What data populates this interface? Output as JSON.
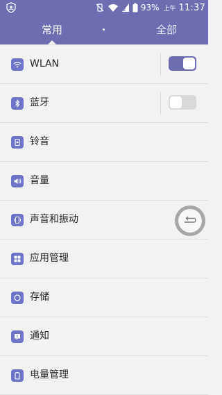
{
  "status_bar": {
    "battery": "93%",
    "time_prefix": "上午",
    "time": "11:37"
  },
  "tabs": [
    {
      "label": "常用",
      "selected": true
    },
    {
      "label": "全部",
      "selected": false
    }
  ],
  "settings": [
    {
      "label": "WLAN",
      "icon": "wifi-icon",
      "toggle": true
    },
    {
      "label": "蓝牙",
      "icon": "bluetooth-icon",
      "toggle": false
    },
    {
      "label": "铃音",
      "icon": "ringtone-icon"
    },
    {
      "label": "音量",
      "icon": "volume-icon"
    },
    {
      "label": "声音和振动",
      "icon": "vibrate-icon"
    },
    {
      "label": "应用管理",
      "icon": "apps-icon"
    },
    {
      "label": "存储",
      "icon": "storage-icon"
    },
    {
      "label": "通知",
      "icon": "notification-icon"
    },
    {
      "label": "电量管理",
      "icon": "battery-manage-icon"
    }
  ],
  "colors": {
    "accent": "#6e6db2",
    "icon_bg": "#6e75c8",
    "background": "#f2f2f2"
  }
}
